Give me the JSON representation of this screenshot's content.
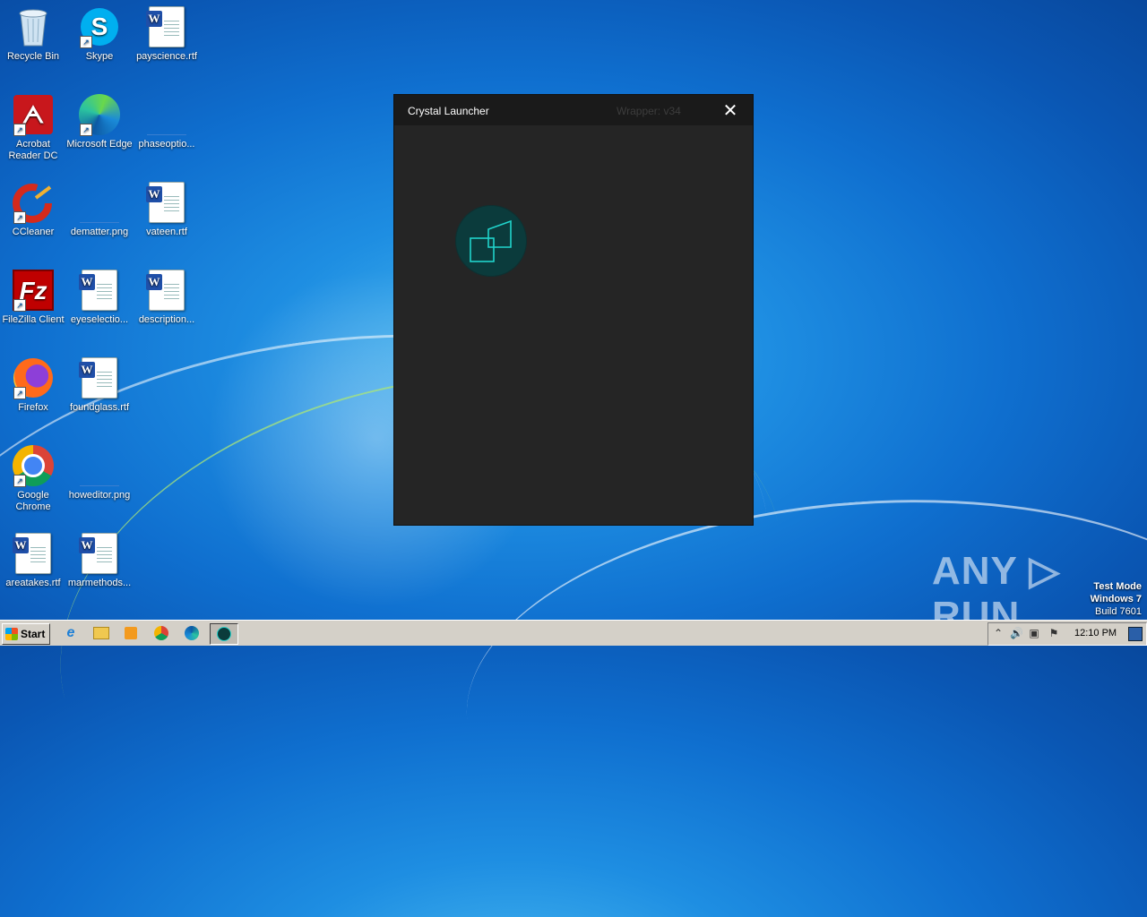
{
  "desktop": {
    "icons": [
      {
        "label": "Recycle Bin",
        "icon": "recycle-bin-icon"
      },
      {
        "label": "Skype",
        "icon": "skype-icon"
      },
      {
        "label": "payscience.rtf",
        "icon": "word-document-icon"
      },
      {
        "label": "Acrobat Reader DC",
        "icon": "acrobat-icon"
      },
      {
        "label": "Microsoft Edge",
        "icon": "edge-icon"
      },
      {
        "label": "phaseoptio...",
        "icon": "image-file-icon"
      },
      {
        "label": "CCleaner",
        "icon": "ccleaner-icon"
      },
      {
        "label": "dematter.png",
        "icon": "image-file-icon"
      },
      {
        "label": "vateen.rtf",
        "icon": "word-document-icon"
      },
      {
        "label": "FileZilla Client",
        "icon": "filezilla-icon"
      },
      {
        "label": "eyeselectio...",
        "icon": "word-document-icon"
      },
      {
        "label": "description...",
        "icon": "word-document-icon"
      },
      {
        "label": "Firefox",
        "icon": "firefox-icon"
      },
      {
        "label": "foundglass.rtf",
        "icon": "word-document-icon"
      },
      {
        "label": "Google Chrome",
        "icon": "chrome-icon"
      },
      {
        "label": "howeditor.png",
        "icon": "image-file-icon"
      },
      {
        "label": "areatakes.rtf",
        "icon": "word-document-icon"
      },
      {
        "label": "marmethods...",
        "icon": "word-document-icon"
      }
    ]
  },
  "window": {
    "title": "Crystal Launcher",
    "version": "Wrapper: v34",
    "close_glyph": "✕"
  },
  "watermark": {
    "text": "ANY ▷ RUN",
    "mode": "Test Mode",
    "os": "Windows 7",
    "build": "Build 7601"
  },
  "taskbar": {
    "start_label": "Start",
    "clock": "12:10 PM"
  }
}
